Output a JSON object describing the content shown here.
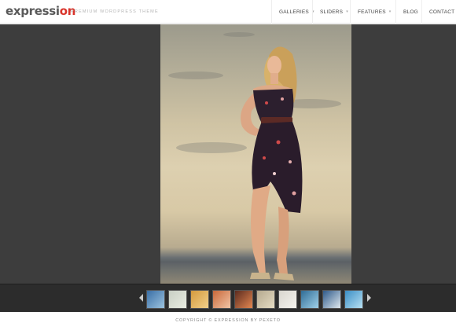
{
  "brand": {
    "logo_main": "expressi",
    "logo_accent": "on",
    "tagline": "PREMIUM WORDPRESS THEME"
  },
  "nav": {
    "items": [
      {
        "label": "GALLERIES",
        "has_dropdown": true
      },
      {
        "label": "SLIDERS",
        "has_dropdown": true
      },
      {
        "label": "FEATURES",
        "has_dropdown": true
      },
      {
        "label": "BLOG",
        "has_dropdown": false
      },
      {
        "label": "CONTACT",
        "has_dropdown": false
      }
    ],
    "caret": "▾"
  },
  "gallery": {
    "main_image": "woman-in-floral-dress-on-beach",
    "thumbnails": [
      {
        "icon": "blue-abstract-thumbnail",
        "color_a": "#3a6fa6",
        "color_b": "#9cc3df"
      },
      {
        "icon": "light-sketch-thumbnail",
        "color_a": "#c8cfc4",
        "color_b": "#e9ece2"
      },
      {
        "icon": "golden-field-thumbnail",
        "color_a": "#d49a3e",
        "color_b": "#f2d08a"
      },
      {
        "icon": "orange-ring-thumbnail",
        "color_a": "#c9683a",
        "color_b": "#f1c4a5"
      },
      {
        "icon": "sunset-tree-thumbnail",
        "color_a": "#5b2b1f",
        "color_b": "#e38650"
      },
      {
        "icon": "woman-beach-thumbnail",
        "color_a": "#b5a98f",
        "color_b": "#e6dcc3"
      },
      {
        "icon": "white-sand-thumbnail",
        "color_a": "#d9d6cf",
        "color_b": "#f5f3ee"
      },
      {
        "icon": "ocean-wave-thumbnail",
        "color_a": "#2f6c96",
        "color_b": "#9fd0e8"
      },
      {
        "icon": "boat-harbor-thumbnail",
        "color_a": "#2f5a8a",
        "color_b": "#dfe8ee"
      },
      {
        "icon": "blue-sky-thumbnail",
        "color_a": "#3b8fc6",
        "color_b": "#b7e0f2"
      }
    ]
  },
  "footer": {
    "copyright": "COPYRIGHT © EXPRESSION BY PEXETO"
  }
}
